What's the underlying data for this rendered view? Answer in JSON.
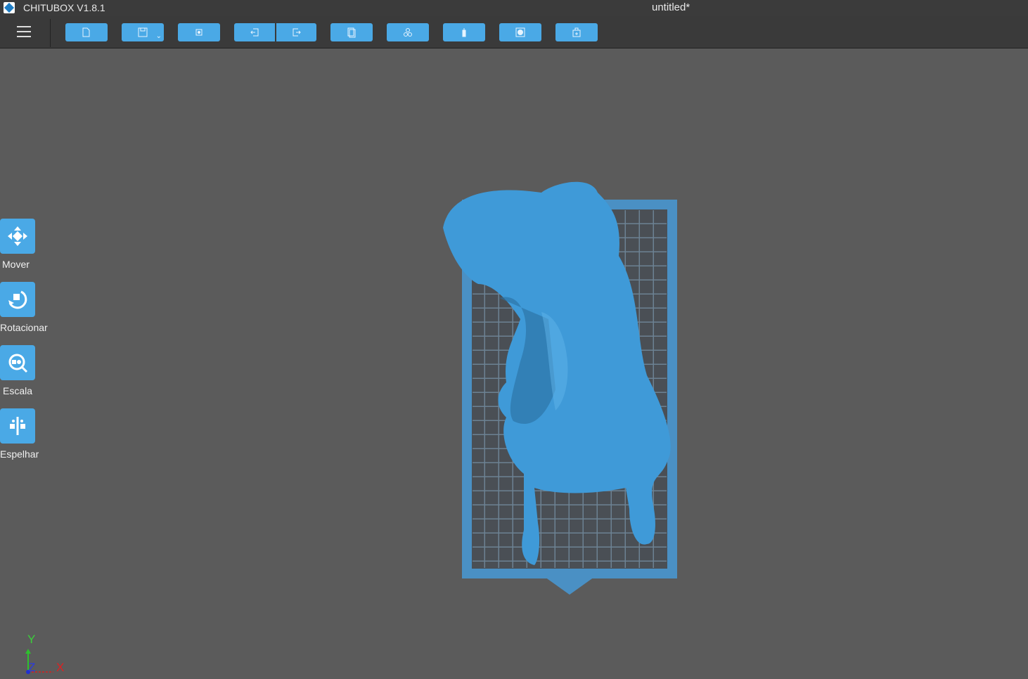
{
  "app": {
    "title": "CHITUBOX V1.8.1",
    "document": "untitled*"
  },
  "toolbar": {
    "buttons": [
      {
        "name": "open-file",
        "icon": "folder-icon"
      },
      {
        "name": "save",
        "icon": "save-icon"
      },
      {
        "name": "screenshot",
        "icon": "crop-icon"
      },
      {
        "name": "undo",
        "icon": "undo-icon"
      },
      {
        "name": "redo",
        "icon": "redo-icon"
      },
      {
        "name": "copy",
        "icon": "copy-icon"
      },
      {
        "name": "arrange",
        "icon": "cubes-icon"
      },
      {
        "name": "support",
        "icon": "support-icon"
      },
      {
        "name": "hollow",
        "icon": "hollow-icon"
      },
      {
        "name": "add-plate",
        "icon": "plate-add-icon"
      }
    ]
  },
  "tools": [
    {
      "label": "Mover",
      "icon": "move-icon"
    },
    {
      "label": "Rotacionar",
      "icon": "rotate-icon"
    },
    {
      "label": "Escala",
      "icon": "scale-icon"
    },
    {
      "label": "Espelhar",
      "icon": "mirror-icon"
    }
  ],
  "axis": {
    "x": "X",
    "y": "Y",
    "z": "Z"
  },
  "colors": {
    "accent": "#4aa9e6",
    "model": "#3f9ad8",
    "viewport": "#5b5b5b"
  }
}
